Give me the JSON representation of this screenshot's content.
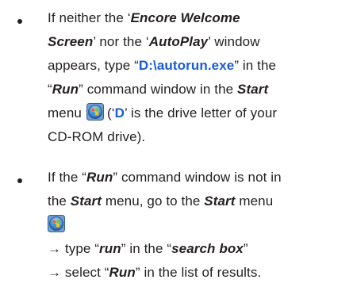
{
  "bullets": [
    {
      "lines": [
        [
          "If neither the ‘",
          "Encore Welcome"
        ],
        [
          "Screen",
          "’ nor the ‘",
          "AutoPlay",
          "’ window"
        ],
        [
          "appears, type “",
          "D:\\autorun.exe",
          "” in the"
        ],
        [
          "“",
          "Run",
          "” command window in the ",
          "Start"
        ],
        [
          "menu",
          "(‘",
          "D",
          "’ is the drive letter of your"
        ],
        [
          "CD-ROM drive)."
        ]
      ]
    },
    {
      "lines": [
        [
          "If the “",
          "Run",
          "” command window is not in"
        ],
        [
          "the ",
          "Start",
          " menu, go to the ",
          "Start",
          " menu"
        ],
        [
          "→ type “",
          "run",
          "” in the “",
          "search box",
          "”"
        ],
        [
          "→ select “",
          "Run",
          "” in the list of results."
        ]
      ]
    }
  ],
  "icons": {
    "start_orb": "windows-start-orb-icon"
  },
  "colors": {
    "text": "#231f20",
    "highlight_blue": "#1a5bd6"
  }
}
